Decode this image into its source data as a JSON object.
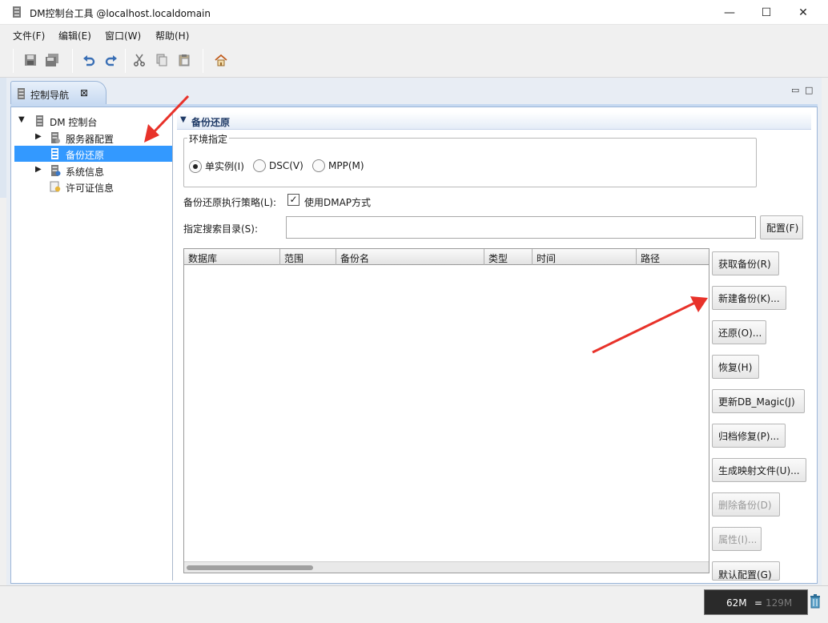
{
  "window": {
    "title": "DM控制台工具 @localhost.localdomain"
  },
  "menu": [
    "文件(F)",
    "编辑(E)",
    "窗口(W)",
    "帮助(H)"
  ],
  "toolbar_icons": [
    "save-icon",
    "save-all-icon",
    "undo-icon",
    "redo-icon",
    "cut-icon",
    "copy-icon",
    "paste-icon",
    "home-icon"
  ],
  "nav_tab": {
    "label": "控制导航",
    "close": "⊠"
  },
  "tree": {
    "root": "DM 控制台",
    "items": [
      "服务器配置",
      "备份还原",
      "系统信息",
      "许可证信息"
    ],
    "selected": "备份还原"
  },
  "section": {
    "title": "备份还原"
  },
  "environment": {
    "legend": "环境指定",
    "options": [
      "单实例(I)",
      "DSC(V)",
      "MPP(M)"
    ],
    "selected": "单实例(I)"
  },
  "strategy": {
    "label": "备份还原执行策略(L):",
    "checkbox_label": "使用DMAP方式",
    "checked": true
  },
  "search_dir": {
    "label": "指定搜索目录(S):",
    "value": "",
    "config_button": "配置(F)"
  },
  "table": {
    "columns": [
      "数据库",
      "范围",
      "备份名",
      "类型",
      "时间",
      "路径"
    ],
    "rows": []
  },
  "actions": [
    {
      "label": "获取备份(R)",
      "enabled": true
    },
    {
      "label": "新建备份(K)...",
      "enabled": true
    },
    {
      "label": "还原(O)...",
      "enabled": true
    },
    {
      "label": "恢复(H)",
      "enabled": true
    },
    {
      "label": "更新DB_Magic(J)",
      "enabled": true
    },
    {
      "label": "归档修复(P)...",
      "enabled": true
    },
    {
      "label": "生成映射文件(U)...",
      "enabled": true
    },
    {
      "label": "删除备份(D)",
      "enabled": false
    },
    {
      "label": "属性(I)...",
      "enabled": false
    },
    {
      "label": "默认配置(G)",
      "enabled": true
    }
  ],
  "status": {
    "heap_used": "62M",
    "heap_separator": "=",
    "heap_total": "129M"
  },
  "colors": {
    "selection": "#3399ff",
    "arrow": "#e8322a",
    "header_text": "#1f3a66"
  }
}
